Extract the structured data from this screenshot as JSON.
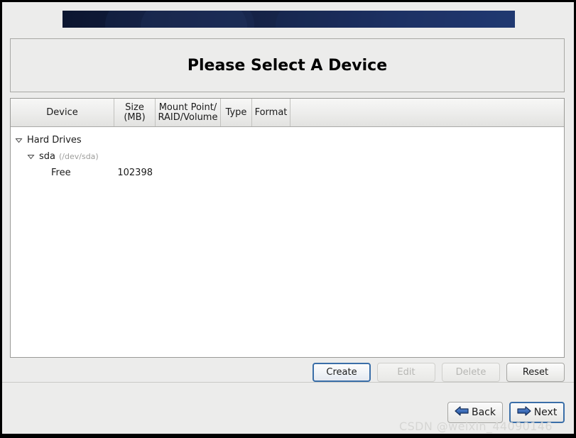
{
  "window": {
    "banner_gradient_from": "#0c1630",
    "banner_gradient_to": "#20386f",
    "background": "#ececeb"
  },
  "header": {
    "title": "Please Select A Device"
  },
  "table": {
    "columns": [
      {
        "key": "device",
        "label": "Device"
      },
      {
        "key": "size",
        "label": "Size\n(MB)",
        "line1": "Size",
        "line2": "(MB)"
      },
      {
        "key": "mount",
        "label": "Mount Point/\nRAID/Volume",
        "line1": "Mount Point/",
        "line2": "RAID/Volume"
      },
      {
        "key": "type",
        "label": "Type"
      },
      {
        "key": "format",
        "label": "Format"
      }
    ],
    "rows": [
      {
        "level": 0,
        "expander": "chevron-down-icon",
        "device": "Hard Drives",
        "detail": "",
        "size": "",
        "mount": "",
        "type": "",
        "format": ""
      },
      {
        "level": 1,
        "expander": "chevron-down-icon",
        "device": "sda",
        "detail": "(/dev/sda)",
        "size": "",
        "mount": "",
        "type": "",
        "format": ""
      },
      {
        "level": 2,
        "expander": "",
        "device": "Free",
        "detail": "",
        "size": "102398",
        "mount": "",
        "type": "",
        "format": ""
      }
    ]
  },
  "actions": {
    "create_label": "Create",
    "edit_label": "Edit",
    "delete_label": "Delete",
    "reset_label": "Reset",
    "focus_color": "#3a6ea8"
  },
  "navigation": {
    "back_label": "Back",
    "back_icon": "arrow-left-icon",
    "next_label": "Next",
    "next_icon": "arrow-right-icon",
    "arrow_color": "#2b5fa8"
  },
  "watermark": {
    "text": "CSDN @weixin_44090146",
    "color": "#d6d6d4"
  }
}
